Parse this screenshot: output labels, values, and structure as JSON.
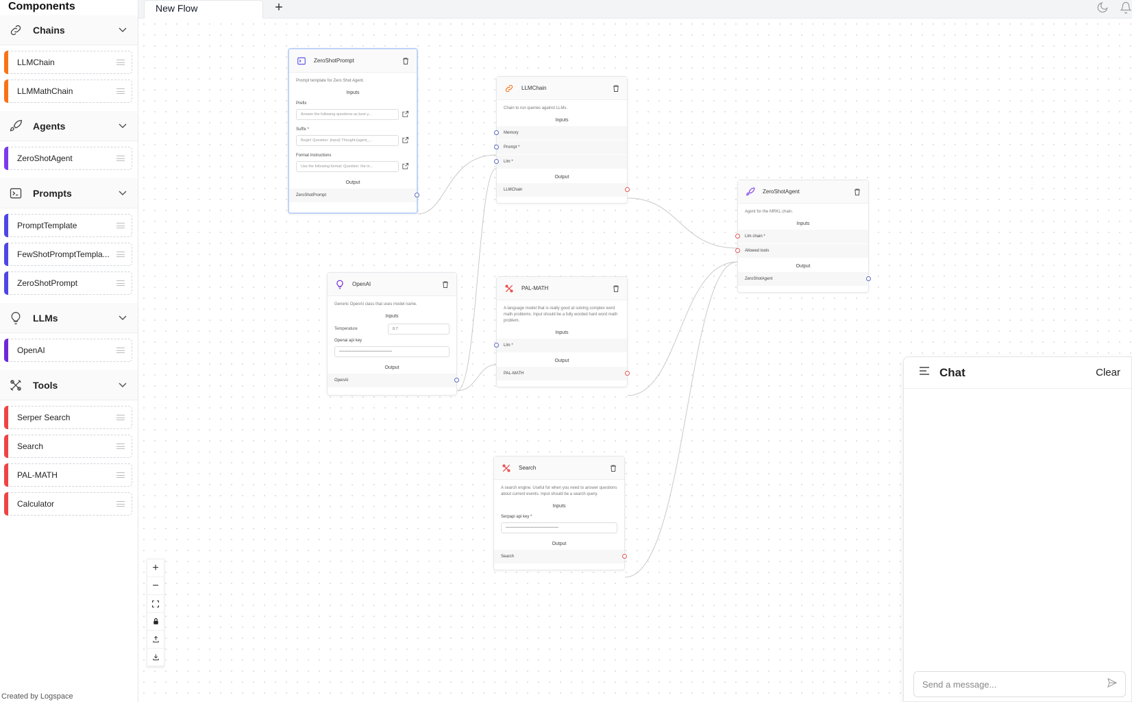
{
  "sidebar": {
    "title": "Components",
    "credit": "Created by Logspace",
    "categories": [
      {
        "label": "Chains",
        "items": [
          {
            "label": "LLMChain"
          },
          {
            "label": "LLMMathChain"
          }
        ]
      },
      {
        "label": "Agents",
        "items": [
          {
            "label": "ZeroShotAgent"
          }
        ]
      },
      {
        "label": "Prompts",
        "items": [
          {
            "label": "PromptTemplate"
          },
          {
            "label": "FewShotPromptTempla..."
          },
          {
            "label": "ZeroShotPrompt"
          }
        ]
      },
      {
        "label": "LLMs",
        "items": [
          {
            "label": "OpenAI"
          }
        ]
      },
      {
        "label": "Tools",
        "items": [
          {
            "label": "Serper Search"
          },
          {
            "label": "Search"
          },
          {
            "label": "PAL-MATH"
          },
          {
            "label": "Calculator"
          }
        ]
      }
    ]
  },
  "topbar": {
    "tab_label": "New Flow",
    "add_tab": "+"
  },
  "colors": {
    "chains": "#f97316",
    "agents": "#7c3aed",
    "prompts": "#4f46e5",
    "llms": "#6d28d9",
    "tools": "#ef4444",
    "handle_in": "#5b6bc0",
    "handle_out": "#e05656"
  },
  "nodes": {
    "zeroshotprompt": {
      "title": "ZeroShotPrompt",
      "description": "Prompt template for Zero Shot Agent.",
      "inputs_label": "Inputs",
      "fields": [
        {
          "label": "Prefix",
          "value": "Answer the following questions as best y..."
        },
        {
          "label": "Suffix *",
          "value": "Begin! Question: {input} Thought:{agent_..."
        },
        {
          "label": "Format Instructions",
          "value": "Use the following format: Question: the in..."
        }
      ],
      "output_label": "Output",
      "output": "ZeroShotPrompt"
    },
    "llmchain": {
      "title": "LLMChain",
      "description": "Chain to run queries against LLMs.",
      "inputs_label": "Inputs",
      "inputs": [
        "Memory",
        "Prompt *",
        "Llm *"
      ],
      "output_label": "Output",
      "output": "LLMChain"
    },
    "zeroshotagent": {
      "title": "ZeroShotAgent",
      "description": "Agent for the MRKL chain.",
      "inputs_label": "Inputs",
      "inputs": [
        "Llm chain *",
        "Allowed tools"
      ],
      "output_label": "Output",
      "output": "ZeroShotAgent"
    },
    "openai": {
      "title": "OpenAI",
      "description": "Generic OpenAI class that uses model name.",
      "inputs_label": "Inputs",
      "temperature_label": "Temperature",
      "temperature_value": "0.7",
      "apikey_label": "Openai api key",
      "apikey_value": "••••••••••••••••••••••••••••••••••••••••",
      "output_label": "Output",
      "output": "OpenAI"
    },
    "palmath": {
      "title": "PAL-MATH",
      "description": "A language model that is really good at solving complex word math problems. Input should be a fully worded hard word math problem.",
      "inputs_label": "Inputs",
      "inputs": [
        "Llm *"
      ],
      "output_label": "Output",
      "output": "PAL-MATH"
    },
    "search": {
      "title": "Search",
      "description": "A search engine. Useful for when you need to answer questions about current events. Input should be a search query.",
      "inputs_label": "Inputs",
      "apikey_label": "Serpapi api key *",
      "apikey_value": "••••••••••••••••••••••••••••••••••••••••",
      "output_label": "Output",
      "output": "Search"
    }
  },
  "chat": {
    "title": "Chat",
    "clear_label": "Clear",
    "placeholder": "Send a message..."
  }
}
